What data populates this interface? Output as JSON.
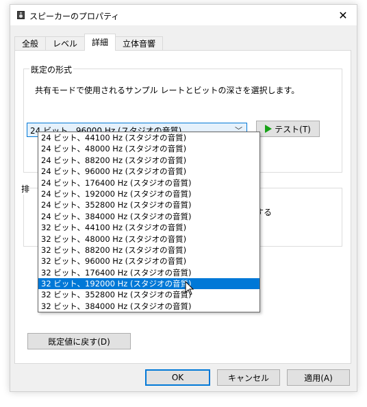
{
  "window": {
    "title": "スピーカーのプロパティ",
    "close_glyph": "✕"
  },
  "tabs": [
    {
      "label": "全般"
    },
    {
      "label": "レベル"
    },
    {
      "label": "詳細"
    },
    {
      "label": "立体音響"
    }
  ],
  "format_group": {
    "legend": "既定の形式",
    "description": "共有モードで使用されるサンプル レートとビットの深さを選択します。",
    "selected_value": "24 ビット、96000 Hz (スタジオの音質)",
    "test_button_label": "テスト(T)",
    "options": [
      "24 ビット、44100 Hz (スタジオの音質)",
      "24 ビット、48000 Hz (スタジオの音質)",
      "24 ビット、88200 Hz (スタジオの音質)",
      "24 ビット、96000 Hz (スタジオの音質)",
      "24 ビット、176400 Hz (スタジオの音質)",
      "24 ビット、192000 Hz (スタジオの音質)",
      "24 ビット、352800 Hz (スタジオの音質)",
      "24 ビット、384000 Hz (スタジオの音質)",
      "32 ビット、44100 Hz (スタジオの音質)",
      "32 ビット、48000 Hz (スタジオの音質)",
      "32 ビット、88200 Hz (スタジオの音質)",
      "32 ビット、96000 Hz (スタジオの音質)",
      "32 ビット、176400 Hz (スタジオの音質)",
      "32 ビット、192000 Hz (スタジオの音質)",
      "32 ビット、352800 Hz (スタジオの音質)",
      "32 ビット、384000 Hz (スタジオの音質)"
    ],
    "highlighted_option": "32 ビット、192000 Hz (スタジオの音質)"
  },
  "exclusive_group": {
    "legend_fragment": "排",
    "text_fragment": "する"
  },
  "restore_button_label": "既定値に戻す(D)",
  "footer": {
    "ok_label": "OK",
    "cancel_label": "キャンセル",
    "apply_label": "適用(A)"
  },
  "colors": {
    "accent": "#0078d7",
    "play": "#17a117"
  }
}
